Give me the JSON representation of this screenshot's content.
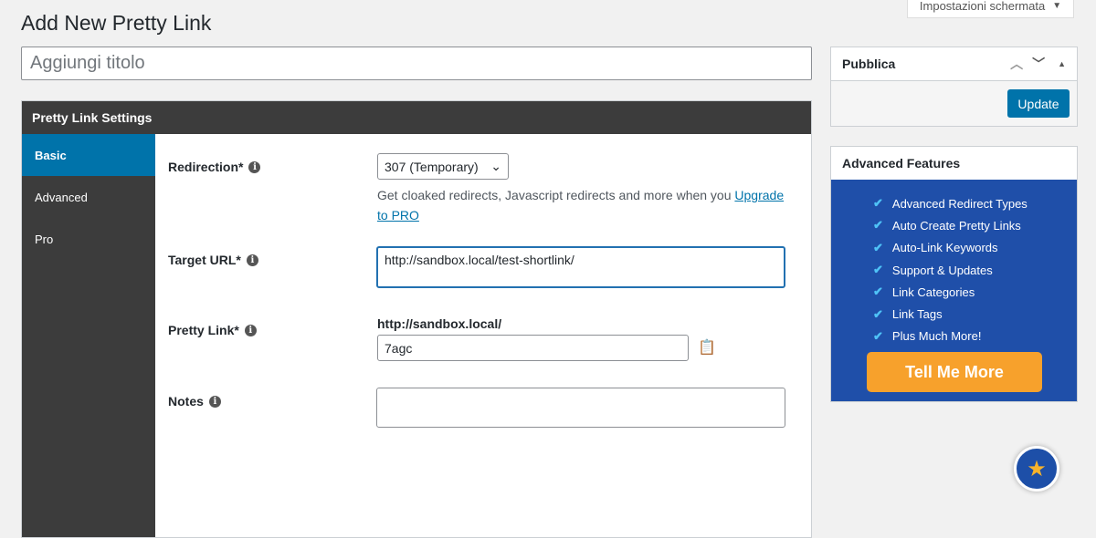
{
  "screen_options": "Impostazioni schermata",
  "page_title": "Add New Pretty Link",
  "title_placeholder": "Aggiungi titolo",
  "settings": {
    "heading": "Pretty Link Settings",
    "tabs": [
      "Basic",
      "Advanced",
      "Pro"
    ],
    "redirection_label": "Redirection*",
    "redirection_value": "307 (Temporary)",
    "upgrade_text": "Get cloaked redirects, Javascript redirects and more when you ",
    "upgrade_link": "Upgrade to PRO",
    "target_label": "Target URL*",
    "target_value": "http://sandbox.local/test-shortlink/",
    "pretty_label": "Pretty Link*",
    "pretty_base": "http://sandbox.local/",
    "pretty_value": "7agc",
    "notes_label": "Notes",
    "notes_value": ""
  },
  "publish": {
    "heading": "Pubblica",
    "update": "Update"
  },
  "advanced": {
    "heading": "Advanced Features",
    "features": [
      "Advanced Redirect Types",
      "Auto Create Pretty Links",
      "Auto-Link Keywords",
      "Support & Updates",
      "Link Categories",
      "Link Tags",
      "Plus Much More!"
    ],
    "button": "Tell Me More"
  }
}
